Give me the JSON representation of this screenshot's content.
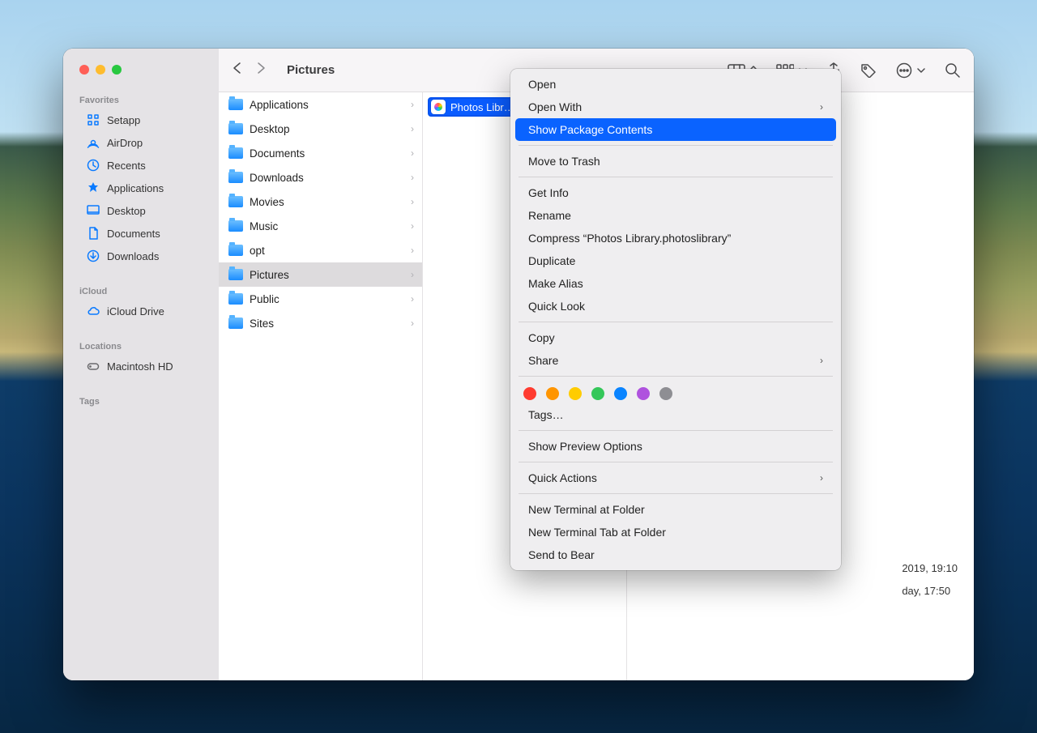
{
  "window_title": "Pictures",
  "sidebar": {
    "sections": [
      {
        "title": "Favorites",
        "items": [
          {
            "icon": "setapp",
            "label": "Setapp"
          },
          {
            "icon": "airdrop",
            "label": "AirDrop"
          },
          {
            "icon": "recents",
            "label": "Recents"
          },
          {
            "icon": "applications",
            "label": "Applications"
          },
          {
            "icon": "desktop",
            "label": "Desktop"
          },
          {
            "icon": "documents",
            "label": "Documents"
          },
          {
            "icon": "downloads",
            "label": "Downloads"
          }
        ]
      },
      {
        "title": "iCloud",
        "items": [
          {
            "icon": "icloud",
            "label": "iCloud Drive"
          }
        ]
      },
      {
        "title": "Locations",
        "items": [
          {
            "icon": "disk",
            "label": "Macintosh HD",
            "gray": true
          }
        ]
      },
      {
        "title": "Tags",
        "items": []
      }
    ]
  },
  "home_folders": [
    "Applications",
    "Desktop",
    "Documents",
    "Downloads",
    "Movies",
    "Music",
    "opt",
    "Pictures",
    "Public",
    "Sites"
  ],
  "home_selected": "Pictures",
  "file_selected_label": "Photos Libr…o",
  "context_menu": {
    "groups": [
      [
        {
          "label": "Open"
        },
        {
          "label": "Open With",
          "submenu": true
        },
        {
          "label": "Show Package Contents",
          "highlight": true
        }
      ],
      [
        {
          "label": "Move to Trash"
        }
      ],
      [
        {
          "label": "Get Info"
        },
        {
          "label": "Rename"
        },
        {
          "label": "Compress “Photos Library.photoslibrary”"
        },
        {
          "label": "Duplicate"
        },
        {
          "label": "Make Alias"
        },
        {
          "label": "Quick Look"
        }
      ],
      [
        {
          "label": "Copy"
        },
        {
          "label": "Share",
          "submenu": true
        }
      ],
      [
        {
          "label": "Tags…",
          "tag_row": true
        }
      ],
      [
        {
          "label": "Show Preview Options"
        }
      ],
      [
        {
          "label": "Quick Actions",
          "submenu": true
        }
      ],
      [
        {
          "label": "New Terminal at Folder"
        },
        {
          "label": "New Terminal Tab at Folder"
        },
        {
          "label": "Send to Bear"
        }
      ]
    ],
    "tag_colors": [
      "#ff3b30",
      "#ff9500",
      "#ffcc00",
      "#34c759",
      "#0a84ff",
      "#af52de",
      "#8e8e93"
    ]
  },
  "preview_dates": {
    "created": "2019, 19:10",
    "modified": "day, 17:50"
  }
}
